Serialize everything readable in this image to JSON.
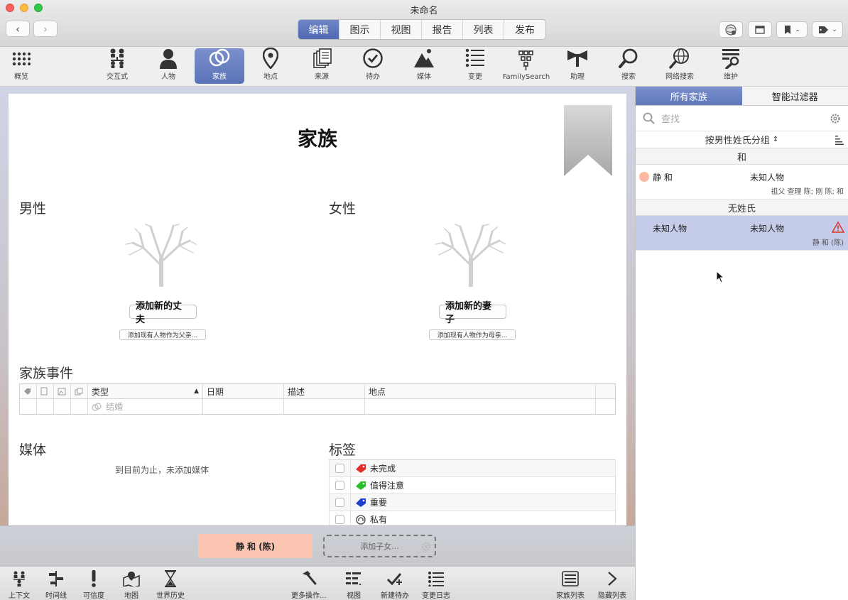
{
  "window": {
    "title": "未命名"
  },
  "nav": {
    "back": "‹",
    "forward": "›"
  },
  "mode_tabs": [
    {
      "label": "编辑",
      "active": true
    },
    {
      "label": "图示",
      "active": false
    },
    {
      "label": "视图",
      "active": false
    },
    {
      "label": "报告",
      "active": false
    },
    {
      "label": "列表",
      "active": false
    },
    {
      "label": "发布",
      "active": false
    }
  ],
  "toolbar": [
    {
      "label": "概览",
      "icon": "grid-icon"
    },
    {
      "label": "交互式",
      "icon": "interactive-tree-icon"
    },
    {
      "label": "人物",
      "icon": "person-icon"
    },
    {
      "label": "家族",
      "icon": "rings-icon",
      "active": true
    },
    {
      "label": "地点",
      "icon": "map-pin-icon"
    },
    {
      "label": "来源",
      "icon": "sources-icon"
    },
    {
      "label": "待办",
      "icon": "todo-check-icon"
    },
    {
      "label": "媒体",
      "icon": "media-icon"
    },
    {
      "label": "变更",
      "icon": "changes-list-icon"
    },
    {
      "label": "FamilySearch",
      "icon": "familysearch-icon"
    },
    {
      "label": "助理",
      "icon": "bowtie-icon"
    },
    {
      "label": "搜索",
      "icon": "search-icon"
    },
    {
      "label": "网络搜索",
      "icon": "web-search-icon"
    },
    {
      "label": "维护",
      "icon": "maintenance-icon"
    }
  ],
  "family": {
    "title": "家族",
    "male_section": "男性",
    "female_section": "女性",
    "add_husband": "添加新的丈夫",
    "add_existing_father": "添加现有人物作为父亲...",
    "add_wife": "添加新的妻子",
    "add_existing_mother": "添加现有人物作为母亲...",
    "events_section": "家族事件",
    "events_columns": [
      "类型",
      "日期",
      "描述",
      "地点"
    ],
    "events_placeholder": "结婚",
    "media_section": "媒体",
    "media_empty": "到目前为止，未添加媒体",
    "tags_section": "标签",
    "tags": [
      {
        "label": "未完成",
        "color": "#e0302a"
      },
      {
        "label": "值得注意",
        "color": "#2cbf2c"
      },
      {
        "label": "重要",
        "color": "#1f3fd0"
      },
      {
        "label": "私有",
        "color": "#555555"
      }
    ]
  },
  "children_bar": {
    "parent_card": "静 和 (陈)",
    "add_child": "添加子女..."
  },
  "bottom_bar": [
    {
      "label": "上下文",
      "icon": "context-icon"
    },
    {
      "label": "时间线",
      "icon": "timeline-icon"
    },
    {
      "label": "可信度",
      "icon": "exclamation-icon"
    },
    {
      "label": "地图",
      "icon": "map-icon"
    },
    {
      "label": "世界历史",
      "icon": "hourglass-icon"
    },
    {
      "label": "更多操作...",
      "icon": "hammer-icon"
    },
    {
      "label": "视图",
      "icon": "view-icon"
    },
    {
      "label": "新建待办",
      "icon": "new-todo-icon"
    },
    {
      "label": "变更日志",
      "icon": "changelog-icon"
    },
    {
      "label": "家族列表",
      "icon": "family-list-icon"
    },
    {
      "label": "隐藏列表",
      "icon": "chevron-right-icon"
    }
  ],
  "sidebar": {
    "tabs": [
      {
        "label": "所有家族",
        "active": true
      },
      {
        "label": "智能过滤器",
        "active": false
      }
    ],
    "search_placeholder": "查找",
    "group_by": "按男性姓氏分组",
    "groups": [
      {
        "header": "和",
        "rows": [
          {
            "partner_a": "静 和",
            "partner_b": "未知人物",
            "sub": "祖父 查理 陈; 刚 陈; 和",
            "selected": false,
            "warning": false
          }
        ]
      },
      {
        "header": "无姓氏",
        "rows": [
          {
            "partner_a": "未知人物",
            "partner_b": "未知人物",
            "sub": "静 和 (陈)",
            "selected": true,
            "warning": true
          }
        ]
      }
    ]
  },
  "colors": {
    "accent": "#5f77bb",
    "selection": "#c5ccea",
    "female_card": "#fbc5b1"
  }
}
